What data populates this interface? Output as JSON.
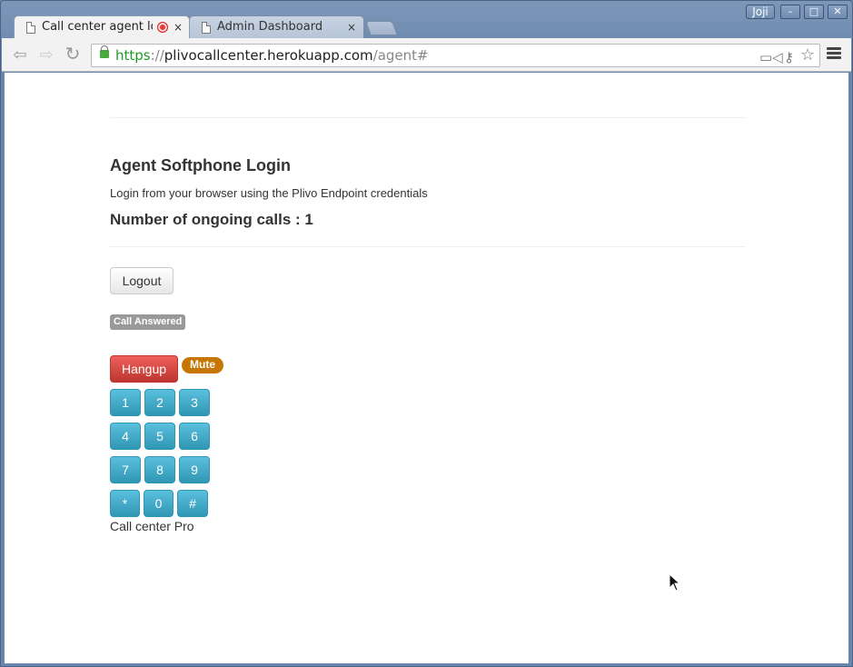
{
  "window": {
    "user_label": "Joji",
    "controls": {
      "minimize": "–",
      "maximize": "□",
      "close": "✕"
    }
  },
  "tabs": [
    {
      "title": "Call center agent lo",
      "icon": "page-icon",
      "recording": true,
      "active": true,
      "close": "×"
    },
    {
      "title": "Admin Dashboard",
      "icon": "page-icon",
      "recording": false,
      "active": false,
      "close": "×"
    }
  ],
  "toolbar": {
    "back_icon": "back-arrow-icon",
    "forward_icon": "forward-arrow-icon",
    "reload_icon": "reload-icon",
    "url": {
      "scheme": "https",
      "separator": "://",
      "host": "plivocallcenter.herokuapp.com",
      "path": "/agent#"
    },
    "omnibox_icons": [
      "camera-icon",
      "key-icon",
      "star-icon"
    ],
    "menu_icon": "hamburger-menu-icon"
  },
  "page": {
    "heading": "Agent Softphone Login",
    "description": "Login from your browser using the Plivo Endpoint credentials",
    "ongoing_calls_label": "Number of ongoing calls : 1",
    "logout_label": "Logout",
    "call_status": "Call Answered",
    "hangup_label": "Hangup",
    "mute_label": "Mute",
    "keypad": [
      [
        "1",
        "2",
        "3"
      ],
      [
        "4",
        "5",
        "6"
      ],
      [
        "7",
        "8",
        "9"
      ],
      [
        "*",
        "0",
        "#"
      ]
    ],
    "footer": "Call center Pro"
  },
  "colors": {
    "hangup": "#d9534f",
    "mute": "#c67605",
    "keypad": "#46b0d1",
    "status_label": "#999999",
    "url_scheme": "#1e9c24"
  }
}
